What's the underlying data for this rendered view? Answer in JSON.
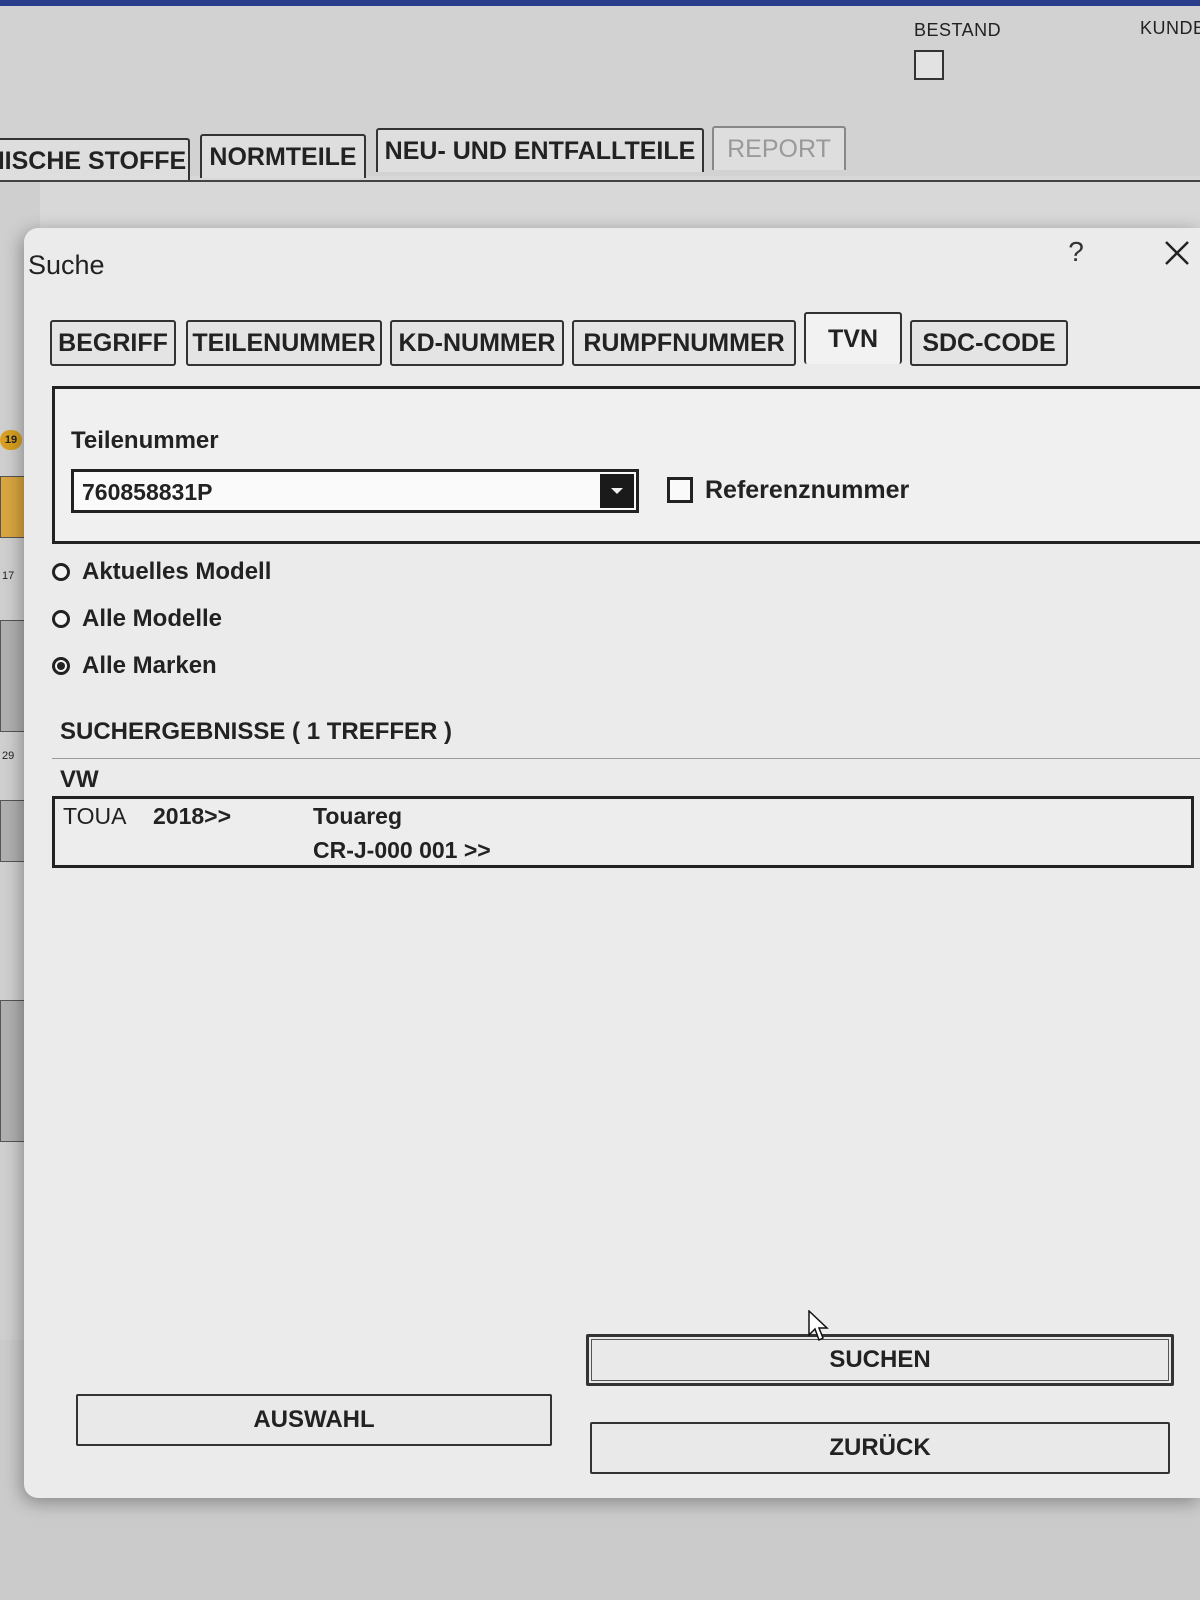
{
  "background": {
    "labels": {
      "bestand": "BESTAND",
      "kunde": "KUNDE"
    },
    "tabs": [
      {
        "label": "MISCHE STOFFE",
        "enabled": true
      },
      {
        "label": "NORMTEILE",
        "enabled": true
      },
      {
        "label": "NEU- UND ENTFALLTEILE",
        "enabled": true
      },
      {
        "label": "REPORT",
        "enabled": false
      }
    ],
    "side_marks": {
      "badge": "19",
      "mark_17": "17",
      "mark_29": "29"
    }
  },
  "dialog": {
    "title": "Suche",
    "help": "?",
    "tabs": [
      {
        "label": "BEGRIFF"
      },
      {
        "label": "TEILENUMMER"
      },
      {
        "label": "KD-NUMMER"
      },
      {
        "label": "RUMPFNUMMER"
      },
      {
        "label": "TVN"
      },
      {
        "label": "SDC-CODE"
      }
    ],
    "active_tab": "TVN",
    "search": {
      "field_label": "Teilenummer",
      "field_value": "760858831P",
      "reference_label": "Referenznummer",
      "reference_checked": false
    },
    "scope_options": [
      {
        "label": "Aktuelles Modell",
        "selected": false
      },
      {
        "label": "Alle Modelle",
        "selected": false
      },
      {
        "label": "Alle Marken",
        "selected": true
      }
    ],
    "results": {
      "heading": "SUCHERGEBNISSE  ( 1 TREFFER )",
      "brand": "VW",
      "rows": [
        {
          "code": "TOUA",
          "year": "2018>>",
          "model": "Touareg",
          "range": "CR-J-000 001 >>"
        }
      ]
    },
    "buttons": {
      "search": "SUCHEN",
      "select": "AUSWAHL",
      "back": "ZURÜCK"
    }
  }
}
